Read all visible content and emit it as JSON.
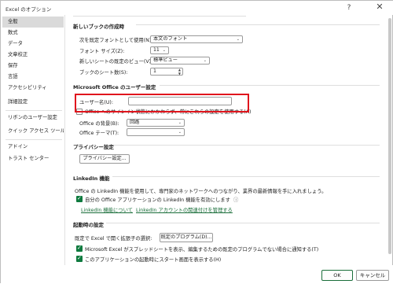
{
  "window": {
    "title": "Excel のオプション",
    "help_glyph": "?",
    "close_glyph": "✕"
  },
  "sidebar": {
    "items": [
      {
        "label": "全般"
      },
      {
        "label": "数式"
      },
      {
        "label": "データ"
      },
      {
        "label": "文章校正"
      },
      {
        "label": "保存"
      },
      {
        "label": "言語"
      },
      {
        "label": "アクセシビリティ"
      },
      {
        "label": "詳細設定"
      },
      {
        "label": "リボンのユーザー設定"
      },
      {
        "label": "クイック アクセス ツール バー"
      },
      {
        "label": "アドイン"
      },
      {
        "label": "トラスト センター"
      }
    ],
    "selected": "全般"
  },
  "new_workbook": {
    "heading": "新しいブックの作成時",
    "font_label": "次を既定フォントとして使用(N):",
    "font_value": "本文のフォント",
    "size_label": "フォント サイズ(Z):",
    "size_value": "11",
    "view_label": "新しいシートの既定のビュー(V):",
    "view_value": "標準ビュー",
    "sheets_label": "ブックのシート数(S):",
    "sheets_value": "1"
  },
  "office_user": {
    "heading": "Microsoft Office のユーザー設定",
    "username_label": "ユーザー名(U):",
    "always_use_label": "Office へのサインイン状態にかかわらず、常にこれらの設定を使用する(A)",
    "background_label": "Office の背景(B):",
    "background_value": "回路",
    "theme_label": "Office テーマ(T):",
    "theme_value": ""
  },
  "privacy": {
    "heading": "プライバシー設定",
    "button_label": "プライバシー設定..."
  },
  "linkedin": {
    "heading": "LinkedIn 機能",
    "description": "Office の LinkedIn 機能を使用して、専門家のネットワークへのつながり、業界の最新情報を手に入れましょう。",
    "enable_label": "自分の Office アプリケーションの LinkedIn 機能を有効にします",
    "info_glyph": "ⓘ",
    "link1": "LinkedIn 機能について",
    "link2": "LinkedIn アカウントの関連付けを管理する"
  },
  "startup": {
    "heading": "起動時の設定",
    "default_ext_label": "既定で Excel で開く拡張子の選択:",
    "default_programs_button": "既定のプログラム(D)...",
    "notify_label": "Microsoft Excel がスプレッドシートを表示、編集するための既定のプログラムでない場合に通知する(T)",
    "show_start_label": "このアプリケーションの起動時にスタート画面を表示する(H)"
  },
  "footer": {
    "ok_label": "OK",
    "cancel_label": "キャンセル"
  },
  "colors": {
    "accent_green": "#0f7b3f",
    "highlight_red": "#e0151d",
    "selected_bg": "#dadada"
  }
}
